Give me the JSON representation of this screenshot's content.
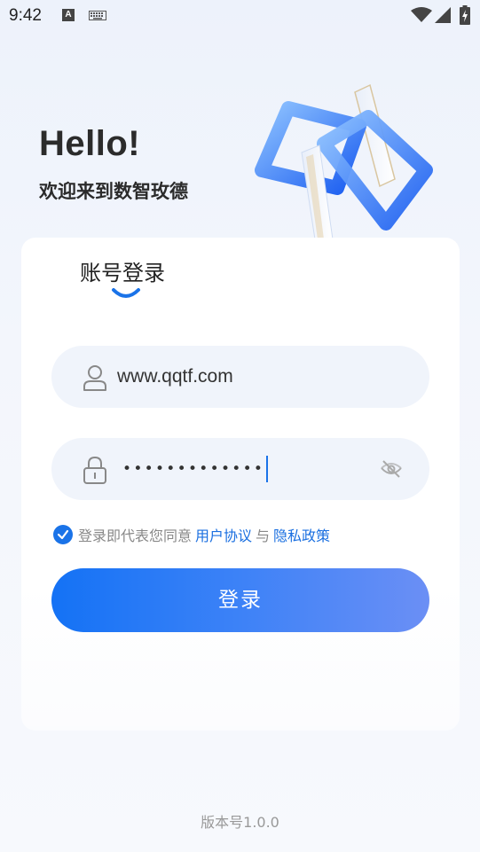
{
  "status_bar": {
    "time": "9:42",
    "a_badge": "A",
    "icons": [
      "a-icon",
      "keyboard-icon",
      "wifi-icon",
      "signal-icon",
      "battery-icon"
    ]
  },
  "header": {
    "greeting": "Hello!",
    "welcome": "欢迎来到数智玫德"
  },
  "login_card": {
    "tab_label": "账号登录",
    "account_value": "www.qqtf.com",
    "password_masked": "•••••••••••••",
    "agreement": {
      "prefix": "登录即代表您同意",
      "user_agreement": "用户协议",
      "and": "与",
      "privacy_policy": "隐私政策",
      "checked": true
    },
    "login_button": "登录"
  },
  "footer": {
    "version": "版本号1.0.0"
  },
  "colors": {
    "accent": "#1a73e8",
    "button_start": "#1472f5",
    "button_end": "#6b8ff5",
    "field_bg": "#f0f4fb"
  }
}
